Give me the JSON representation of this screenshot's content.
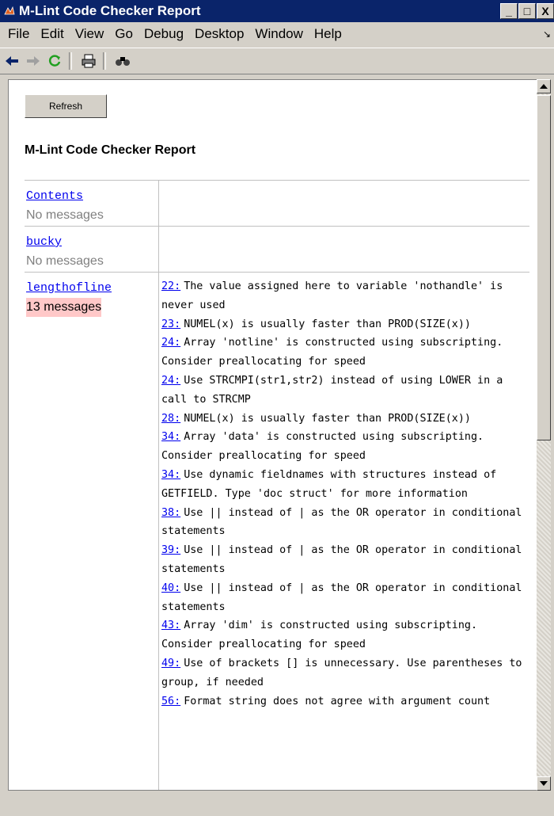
{
  "window": {
    "title": "M-Lint Code Checker Report",
    "btn_min": "_",
    "btn_max": "□",
    "btn_close": "X"
  },
  "menu": [
    "File",
    "Edit",
    "View",
    "Go",
    "Debug",
    "Desktop",
    "Window",
    "Help"
  ],
  "toolbar": {
    "icons": [
      "back-icon",
      "forward-icon",
      "refresh-icon",
      "print-icon",
      "find-icon"
    ]
  },
  "page": {
    "refresh_label": "Refresh",
    "heading": "M-Lint Code Checker Report",
    "files": [
      {
        "name": "Contents",
        "count": "No messages",
        "messages": []
      },
      {
        "name": "bucky",
        "count": "No messages",
        "messages": []
      },
      {
        "name": "lengthofline",
        "count": "13 messages",
        "messages": [
          {
            "line": "22:",
            "text": "The value assigned here to variable 'nothandle' is never used"
          },
          {
            "line": "23:",
            "text": "NUMEL(x) is usually faster than PROD(SIZE(x))"
          },
          {
            "line": "24:",
            "text": "Array 'notline' is constructed using subscripting. Consider preallocating for speed"
          },
          {
            "line": "24:",
            "text": "Use STRCMPI(str1,str2) instead of using LOWER in a call to STRCMP"
          },
          {
            "line": "28:",
            "text": "NUMEL(x) is usually faster than PROD(SIZE(x))"
          },
          {
            "line": "34:",
            "text": "Array 'data' is constructed using subscripting. Consider preallocating for speed"
          },
          {
            "line": "34:",
            "text": "Use dynamic fieldnames with structures instead of GETFIELD. Type 'doc struct' for more information"
          },
          {
            "line": "38:",
            "text": "Use || instead of | as the OR operator in conditional statements"
          },
          {
            "line": "39:",
            "text": "Use || instead of | as the OR operator in conditional statements"
          },
          {
            "line": "40:",
            "text": "Use || instead of | as the OR operator in conditional statements"
          },
          {
            "line": "43:",
            "text": "Array 'dim' is constructed using subscripting. Consider preallocating for speed"
          },
          {
            "line": "49:",
            "text": "Use of brackets [] is unnecessary. Use parentheses to group, if needed"
          },
          {
            "line": "56:",
            "text": "Format string does not agree with argument count"
          }
        ]
      }
    ]
  }
}
